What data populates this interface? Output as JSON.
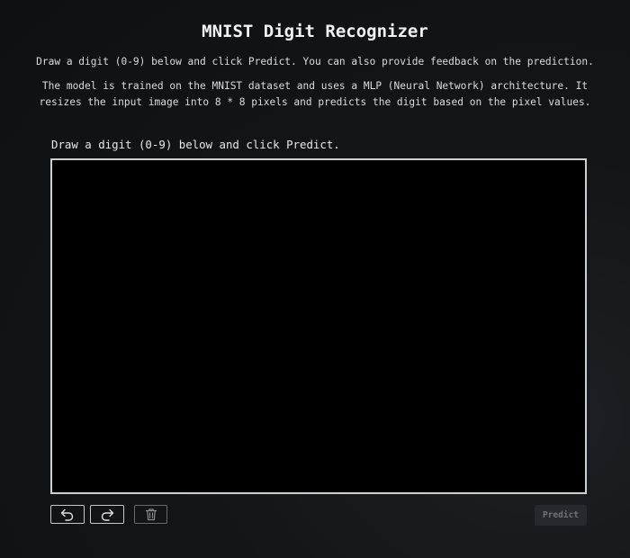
{
  "header": {
    "title": "MNIST Digit Recognizer"
  },
  "intro": {
    "line1": "Draw a digit (0-9) below and click Predict. You can also provide feedback on the prediction.",
    "line2": "The model is trained on the MNIST dataset and uses a MLP (Neural Network) architecture. It resizes the input image into 8 * 8 pixels and predicts the digit based on the pixel values."
  },
  "canvas": {
    "label": "Draw a digit (0-9) below and click Predict.",
    "background_color": "#000000",
    "border_color": "#cfcfcf"
  },
  "toolbar": {
    "undo_icon": "undo-icon",
    "redo_icon": "redo-icon",
    "clear_icon": "trash-icon",
    "predict_label": "Predict"
  },
  "colors": {
    "background": "#131517",
    "text": "#e6e6e6",
    "predict_button_bg": "#26292d",
    "predict_button_text": "#6f7378"
  }
}
